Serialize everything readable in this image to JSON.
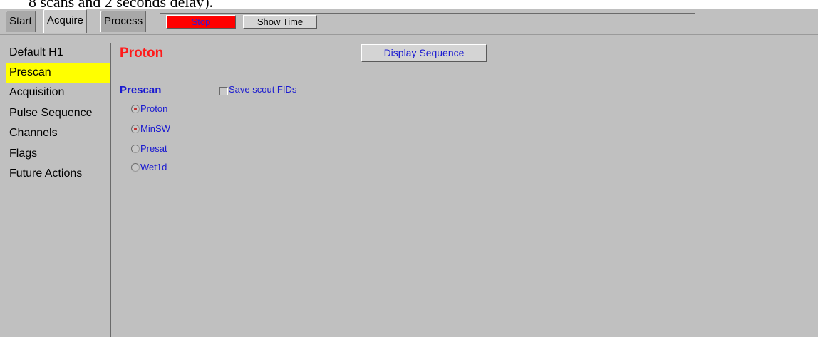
{
  "document": {
    "fragment_text": "8 scans and 2 seconds delay)."
  },
  "tabs": [
    {
      "label": "Start"
    },
    {
      "label": "Acquire"
    },
    {
      "label": "Process"
    }
  ],
  "toolbar": {
    "stop_label": "Stop",
    "show_time_label": "Show Time"
  },
  "sidebar": {
    "items": [
      {
        "label": "Default H1"
      },
      {
        "label": "Prescan",
        "selected": true
      },
      {
        "label": "Acquisition"
      },
      {
        "label": "Pulse Sequence"
      },
      {
        "label": "Channels"
      },
      {
        "label": "Flags"
      },
      {
        "label": "Future Actions"
      }
    ]
  },
  "main": {
    "title": "Proton",
    "display_sequence_label": "Display Sequence",
    "prescan_group": {
      "title": "Prescan",
      "save_scout_label": "Save scout FIDs",
      "save_scout_checked": false,
      "options": [
        {
          "label": "Proton",
          "checked": true
        },
        {
          "label": "MinSW",
          "checked": true
        },
        {
          "label": "Presat",
          "checked": false
        },
        {
          "label": "Wet1d",
          "checked": false
        }
      ]
    }
  },
  "colors": {
    "panel_bg": "#c0c0c0",
    "selected_item": "#ffff00",
    "stop_button": "#ff0000",
    "title_red": "#ff1a1a",
    "label_blue": "#1a1ad0"
  }
}
